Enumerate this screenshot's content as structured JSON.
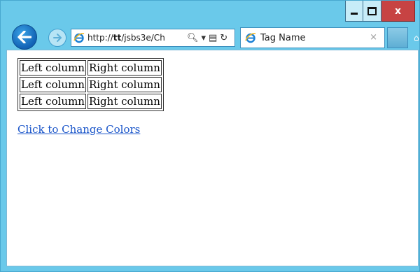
{
  "browser": {
    "address_url_prefix": "http://",
    "address_url_host": "tt",
    "address_url_path": "/jsbs3e/Ch",
    "tab_title": "Tag Name",
    "tab_close": "×",
    "close_label": "x"
  },
  "page": {
    "table_rows": [
      [
        "Left column",
        "Right column"
      ],
      [
        "Left column",
        "Right column"
      ],
      [
        "Left column",
        "Right column"
      ]
    ],
    "link_text": "Click to Change Colors"
  }
}
